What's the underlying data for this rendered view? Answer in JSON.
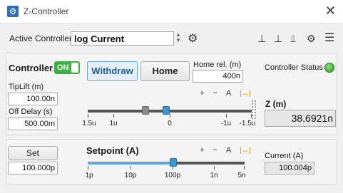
{
  "window": {
    "title": "Z-Controller",
    "close_glyph": "✕"
  },
  "toolbar": {
    "active_controller_label": "Active Controller",
    "active_controller_value": "log Current",
    "icons": [
      "gear-icon",
      "axis-up-icon",
      "axis-down-icon",
      "axis-split-icon",
      "settings-export-icon",
      "menu-icon"
    ]
  },
  "controller": {
    "label": "Controller",
    "toggle_label": "ON",
    "toggle_color": "#3cb043",
    "withdraw_label": "Withdraw",
    "home_label": "Home",
    "home_rel_label": "Home rel. (m)",
    "home_rel_value": "400n",
    "status_label": "Controller Status",
    "status_color": "#3cb043"
  },
  "tip": {
    "tiplift_label": "TipLift (m)",
    "tiplift_value": "100.00n",
    "offdelay_label": "Off Delay (s)",
    "offdelay_value": "500.00m"
  },
  "z_slider": {
    "controls": [
      "+",
      "−",
      "A"
    ],
    "tick_labels": [
      "1.5u",
      "1u",
      "0",
      "-1u",
      "-1.5u"
    ],
    "thumb_position_fraction": 0.48,
    "limit_position_fraction": 0.35
  },
  "z_readout": {
    "label": "Z (m)",
    "value": "38.6921n"
  },
  "setpoint": {
    "set_label": "Set",
    "set_value": "100.000p",
    "label": "Setpoint (A)",
    "controls": [
      "+",
      "−",
      "A"
    ],
    "tick_labels": [
      "1p",
      "10p",
      "100p",
      "1n",
      "5n"
    ],
    "thumb_position_fraction": 0.545
  },
  "current": {
    "label": "Current (A)",
    "value": "100.004p"
  },
  "colors": {
    "accent": "#3b9ad6",
    "range_icon": "#d48a00"
  }
}
